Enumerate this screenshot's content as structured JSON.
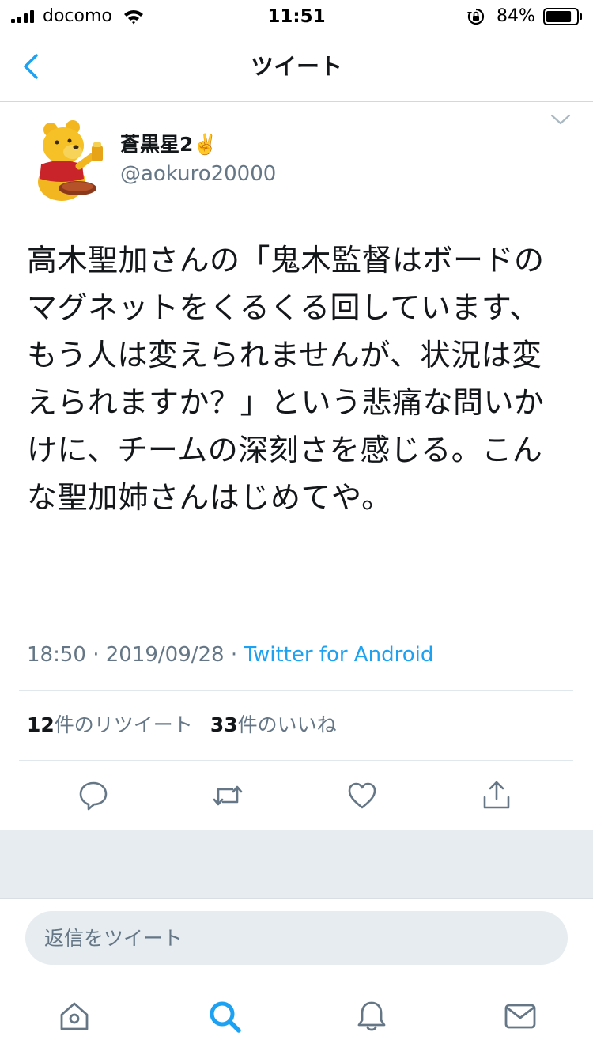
{
  "status_bar": {
    "carrier": "docomo",
    "time": "11:51",
    "battery_percent": "84%",
    "battery_level": 0.84,
    "icons": [
      "signal-icon",
      "wifi-icon",
      "rotation-lock-icon",
      "battery-icon"
    ]
  },
  "nav": {
    "title": "ツイート",
    "back_icon": "chevron-left-icon"
  },
  "tweet": {
    "author": {
      "display_name": "蒼黒星2",
      "emoji": "✌️",
      "handle": "@aokuro20000",
      "avatar": "winnie-the-pooh-figure"
    },
    "text": "高木聖加さんの「鬼木監督はボードのマグネットをくるくる回しています、もう人は変えられませんが、状況は変えられますか？」という悲痛な問いかけに、チームの深刻さを感じる。こんな聖加姉さんはじめてや。",
    "time": "18:50",
    "separator": "·",
    "date": "2019/09/28",
    "source": "Twitter for Android",
    "retweet_count": "12",
    "retweet_label": "件のリツイート",
    "like_count": "33",
    "like_label": "件のいいね"
  },
  "actions": [
    "reply-icon",
    "retweet-icon",
    "like-icon",
    "share-icon"
  ],
  "reply": {
    "placeholder": "返信をツイート"
  },
  "tabbar": [
    "home-icon",
    "search-icon",
    "notifications-icon",
    "messages-icon"
  ],
  "colors": {
    "accent": "#1da1f2",
    "text": "#14171a",
    "secondary": "#657786",
    "divider": "#e1e8ed",
    "background_gray": "#e6ecf0"
  }
}
